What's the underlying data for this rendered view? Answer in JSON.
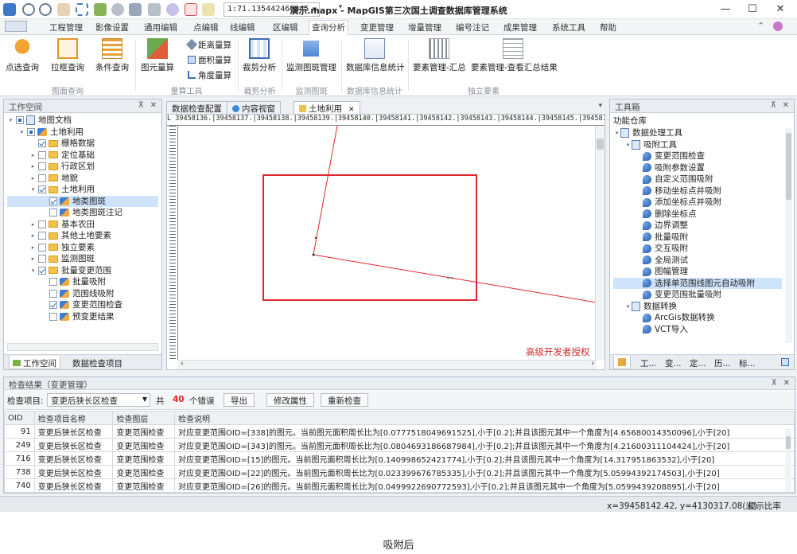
{
  "window": {
    "title": "演示.mapx - MapGIS第三次国土调查数据库管理系统",
    "scale": "1:71.135442469845"
  },
  "menu": [
    "工程管理",
    "影像设置",
    "通用编辑",
    "点编辑",
    "线编辑",
    "区编辑",
    "查询分析",
    "变更管理",
    "增量管理",
    "编号注记",
    "成果管理",
    "系统工具",
    "帮助"
  ],
  "ribbon": {
    "buttons": {
      "point_query": "点选查询",
      "box_query": "拉框查询",
      "condition_query": "条件查询",
      "area_calc": "图元量算",
      "distance_calc": "距离量算",
      "surface_calc": "面积量算",
      "angle_calc": "角度量算",
      "clip_analysis": "裁剪分析",
      "monitor_spot": "监测图斑管理",
      "db_stats": "数据库信息统计",
      "feature_summary": "要素管理-汇总",
      "feature_view_summary": "要素管理-查看汇总结果"
    },
    "groups": {
      "query": "图面查询",
      "measure": "量算工具",
      "clip": "裁剪分析",
      "monitor": "监测图斑",
      "dbinfo": "数据库信息统计",
      "independent": "独立要素"
    }
  },
  "workspace": {
    "title": "工作空间",
    "tabs": [
      "工作空间",
      "数据检查项目"
    ],
    "tree": [
      {
        "label": "地图文档",
        "level": 0,
        "icon": "doc",
        "exp": "▾",
        "cb": "part"
      },
      {
        "label": "土地利用",
        "level": 1,
        "icon": "layer",
        "exp": "▾",
        "cb": "part"
      },
      {
        "label": "栅格数据",
        "level": 2,
        "icon": "folder",
        "exp": "",
        "cb": "checked"
      },
      {
        "label": "定位基础",
        "level": 2,
        "icon": "folder",
        "exp": "▸",
        "cb": ""
      },
      {
        "label": "行政区划",
        "level": 2,
        "icon": "folder",
        "exp": "▸",
        "cb": ""
      },
      {
        "label": "地貌",
        "level": 2,
        "icon": "folder",
        "exp": "▸",
        "cb": ""
      },
      {
        "label": "土地利用",
        "level": 2,
        "icon": "folder",
        "exp": "▾",
        "cb": "checked"
      },
      {
        "label": "地类图斑",
        "level": 3,
        "icon": "layer",
        "exp": "",
        "cb": "checked",
        "selected": true
      },
      {
        "label": "地类图斑注记",
        "level": 3,
        "icon": "layer",
        "exp": "",
        "cb": ""
      },
      {
        "label": "基本农田",
        "level": 2,
        "icon": "folder",
        "exp": "▸",
        "cb": ""
      },
      {
        "label": "其他土地要素",
        "level": 2,
        "icon": "folder",
        "exp": "▸",
        "cb": ""
      },
      {
        "label": "独立要素",
        "level": 2,
        "icon": "folder",
        "exp": "▸",
        "cb": ""
      },
      {
        "label": "监测图斑",
        "level": 2,
        "icon": "folder",
        "exp": "▸",
        "cb": ""
      },
      {
        "label": "批量变更范围",
        "level": 2,
        "icon": "folder",
        "exp": "▾",
        "cb": "checked"
      },
      {
        "label": "批量吸附",
        "level": 3,
        "icon": "layer",
        "exp": "",
        "cb": ""
      },
      {
        "label": "范围线吸附",
        "level": 3,
        "icon": "layer",
        "exp": "",
        "cb": ""
      },
      {
        "label": "变更范围检查",
        "level": 3,
        "icon": "layer",
        "exp": "",
        "cb": "checked"
      },
      {
        "label": "预变更结果",
        "level": 3,
        "icon": "layer",
        "exp": "",
        "cb": ""
      }
    ]
  },
  "doc_tabs": [
    "数据检查配置",
    "内容视窗",
    "土地利用"
  ],
  "ruler_text": "L 39458136.|39458137.|39458138.|39458139.|39458140.|39458141.|39458142.|39458143.|39458144.|39458145.|39458146.|39458",
  "watermark": "高级开发者授权",
  "toolbox": {
    "title": "工具箱",
    "subtitle": "功能仓库",
    "tree": [
      {
        "label": "数据处理工具",
        "level": 0,
        "icon": "doc",
        "exp": "▾"
      },
      {
        "label": "吸附工具",
        "level": 1,
        "icon": "doc",
        "exp": "▾"
      },
      {
        "label": "变更范围检查",
        "level": 2,
        "icon": "tool",
        "exp": ""
      },
      {
        "label": "吸附参数设置",
        "level": 2,
        "icon": "tool",
        "exp": ""
      },
      {
        "label": "自定义范围吸附",
        "level": 2,
        "icon": "tool",
        "exp": ""
      },
      {
        "label": "移动坐标点并吸附",
        "level": 2,
        "icon": "tool",
        "exp": ""
      },
      {
        "label": "添加坐标点并吸附",
        "level": 2,
        "icon": "tool",
        "exp": ""
      },
      {
        "label": "删除坐标点",
        "level": 2,
        "icon": "tool",
        "exp": ""
      },
      {
        "label": "边界调整",
        "level": 2,
        "icon": "tool",
        "exp": ""
      },
      {
        "label": "批量吸附",
        "level": 2,
        "icon": "tool",
        "exp": ""
      },
      {
        "label": "交互吸附",
        "level": 2,
        "icon": "tool",
        "exp": ""
      },
      {
        "label": "全局测试",
        "level": 2,
        "icon": "tool",
        "exp": ""
      },
      {
        "label": "图幅管理",
        "level": 2,
        "icon": "tool",
        "exp": ""
      },
      {
        "label": "选择单范围线图元自动吸附",
        "level": 2,
        "icon": "tool",
        "exp": "",
        "selected": true
      },
      {
        "label": "变更范围批量吸附",
        "level": 2,
        "icon": "tool",
        "exp": ""
      },
      {
        "label": "数据转换",
        "level": 1,
        "icon": "doc",
        "exp": "▾"
      },
      {
        "label": "ArcGis数据转换",
        "level": 2,
        "icon": "tool",
        "exp": ""
      },
      {
        "label": "VCT导入",
        "level": 2,
        "icon": "tool",
        "exp": ""
      }
    ],
    "bottom_tabs": [
      "工...",
      "变...",
      "定...",
      "历...",
      "标..."
    ]
  },
  "results": {
    "title": "检查结果（变更管理）",
    "item_label": "检查项目:",
    "item_value": "变更后狭长区检查",
    "total_prefix": "共",
    "count": "40",
    "count_suffix": "个错误",
    "buttons": {
      "export": "导出",
      "edit_attr": "修改属性",
      "recheck": "重新检查"
    },
    "columns": [
      "OID",
      "检查项目名称",
      "检查图层",
      "检查说明"
    ],
    "rows": [
      [
        "91",
        "变更后狭长区检查",
        "变更范围检查",
        "对应变更范围OID=[338]的图元。当前图元面积周长比为[0.0777518049691525],小于[0.2];并且该图元其中一个角度为[4.65680014350096],小于[20]"
      ],
      [
        "249",
        "变更后狭长区检查",
        "变更范围检查",
        "对应变更范围OID=[343]的图元。当前图元面积周长比为[0.0804693186687984],小于[0.2];并且该图元其中一个角度为[4.21600311104424],小于[20]"
      ],
      [
        "716",
        "变更后狭长区检查",
        "变更范围检查",
        "对应变更范围OID=[15]的图元。当前图元面积周长比为[0.140998652421774],小于[0.2];并且该图元其中一个角度为[14.317951863532],小于[20]"
      ],
      [
        "738",
        "变更后狭长区检查",
        "变更范围检查",
        "对应变更范围OID=[22]的图元。当前图元面积周长比为[0.023399676785335],小于[0.2];并且该图元其中一个角度为[5.05994392174503],小于[20]"
      ],
      [
        "740",
        "变更后狭长区检查",
        "变更范围检查",
        "对应变更范围OID=[26]的图元。当前图元面积周长比为[0.0499922690772593],小于[0.2];并且该图元其中一个角度为[5.0599439208895],小于[20]"
      ]
    ]
  },
  "status": {
    "coords": "x=39458142.42, y=4130317.08(米)",
    "display": "显示比率"
  },
  "caption": "吸附后",
  "colors": {
    "accent": "#1b6fc4",
    "highlight_box": "#e0262a",
    "line": "#e0262a"
  }
}
